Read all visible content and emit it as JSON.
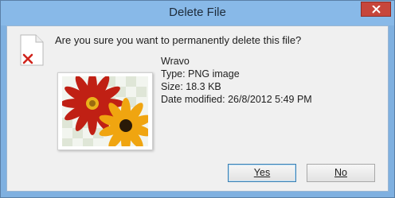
{
  "window": {
    "title": "Delete File"
  },
  "dialog": {
    "question": "Are you sure you want to permanently delete this file?",
    "file": {
      "name": "Wravo",
      "type": "Type: PNG image",
      "size": "Size: 18.3 KB",
      "date_modified": "Date modified: 26/8/2012 5:49 PM"
    }
  },
  "buttons": {
    "yes_label": "Yes",
    "no_label": "No"
  },
  "icons": {
    "close": "close-icon",
    "delete": "delete-file-icon",
    "thumbnail": "image-thumbnail"
  },
  "colors": {
    "titlebar": "#88b9e8",
    "close_button": "#c7463b",
    "dialog_bg": "#f0f0f0",
    "focus_border": "#3c7fb1"
  }
}
